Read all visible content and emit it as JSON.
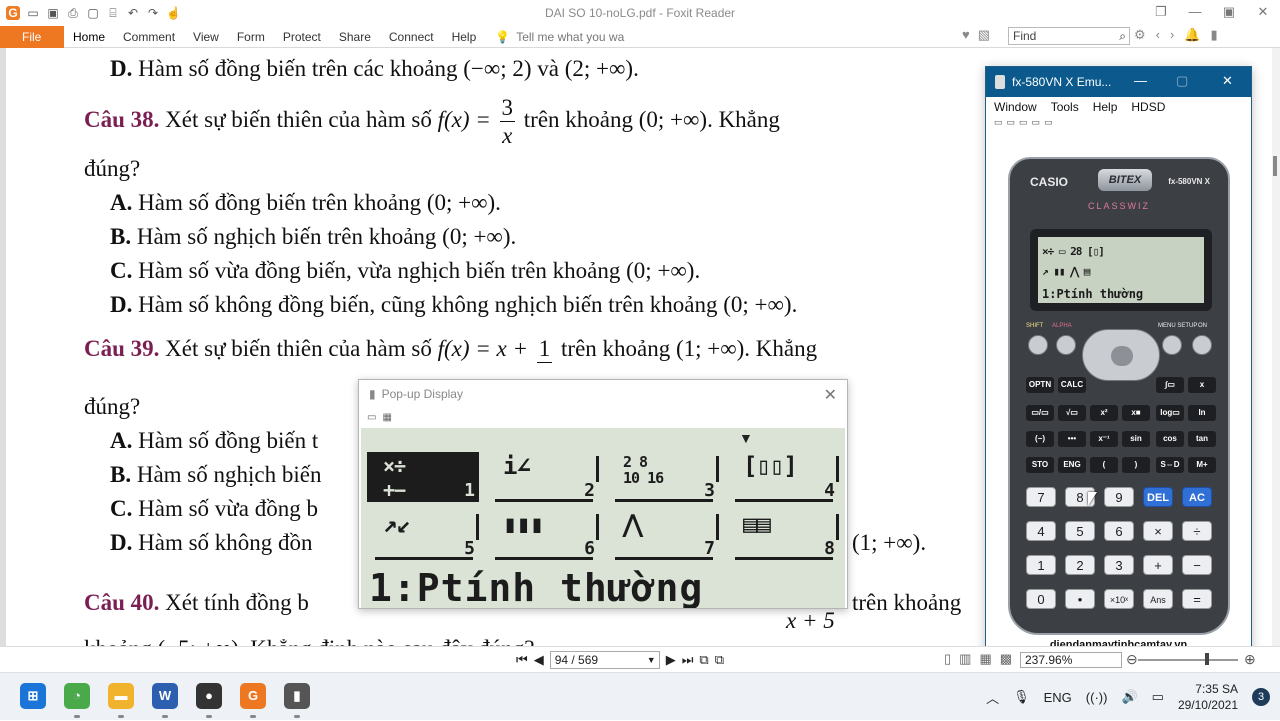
{
  "window": {
    "title": "DAI SO 10-noLG.pdf - Foxit Reader"
  },
  "ribbon": {
    "file": "File",
    "tabs": [
      "Home",
      "Comment",
      "View",
      "Form",
      "Protect",
      "Share",
      "Connect",
      "Help"
    ],
    "tell_me": "Tell me what you wa",
    "find_placeholder": "Find"
  },
  "document": {
    "line_d_top": "Hàm số đồng biến trên các khoảng (−∞; 2) và (2; +∞).",
    "q38": {
      "label": "Câu 38.",
      "text_before": "Xét sự biến thiên của hàm số",
      "func": "f(x) =",
      "num": "3",
      "den": "x",
      "text_after": "trên khoảng (0; +∞). Khẳng",
      "cont": "đúng?",
      "options": [
        {
          "letter": "A.",
          "text": "Hàm số đồng biến trên khoảng (0; +∞)."
        },
        {
          "letter": "B.",
          "text": "Hàm số nghịch biến trên khoảng (0; +∞)."
        },
        {
          "letter": "C.",
          "text": "Hàm số vừa đồng biến, vừa nghịch biến trên khoảng (0; +∞)."
        },
        {
          "letter": "D.",
          "text": "Hàm số không đồng biến, cũng không nghịch biến trên khoảng (0; +∞)."
        }
      ]
    },
    "q39": {
      "label": "Câu 39.",
      "text_before": "Xét sự biến thiên của hàm số",
      "func": "f(x) = x +",
      "num": "1",
      "den": "",
      "text_after": "trên khoảng (1; +∞). Khẳng",
      "cont": "đúng?",
      "options": [
        {
          "letter": "A.",
          "text": "Hàm số đồng biến t"
        },
        {
          "letter": "B.",
          "text": "Hàm số nghịch biến"
        },
        {
          "letter": "C.",
          "text": "Hàm số vừa đồng b"
        },
        {
          "letter": "D.",
          "text": "Hàm số không đồn"
        }
      ],
      "d_tail": "(1; +∞)."
    },
    "q40": {
      "label": "Câu 40.",
      "text_before": "Xét tính đồng b",
      "den_tail": "x + 5",
      "text_after": "trên khoảng"
    },
    "bottom_cut": "khoảng (−5; +∞). Khẳng định nào sau đây đúng?"
  },
  "statusbar": {
    "page": "94 / 569",
    "zoom": "237.96%"
  },
  "popup": {
    "title": "Pop-up Display",
    "menu_items": [
      {
        "glyph": "×÷\n+−",
        "num": "1",
        "selected": true
      },
      {
        "glyph": "i∠",
        "num": "2",
        "selected": false
      },
      {
        "glyph": "2 8\n10 16",
        "num": "3",
        "selected": false
      },
      {
        "glyph": "[▯▯]",
        "num": "4",
        "selected": false
      },
      {
        "glyph": "↗↙",
        "num": "5",
        "selected": false
      },
      {
        "glyph": "▮▮▮",
        "num": "6",
        "selected": false
      },
      {
        "glyph": "⋀",
        "num": "7",
        "selected": false
      },
      {
        "glyph": "▤▤",
        "num": "8",
        "selected": false
      }
    ],
    "status_text": "1:Ptính thường"
  },
  "emulator": {
    "title": "fx-580VN X Emu...",
    "menu": [
      "Window",
      "Tools",
      "Help",
      "HDSD"
    ],
    "brand": "CASIO",
    "badge": "BITEX",
    "model": "fx-580VN X",
    "series": "CLASSWIZ",
    "screen_row1": "×÷ ▭ 28 [▯]",
    "screen_row2": "↗ ▮▮ ⋀ ▤",
    "screen_text": "1:Ptính thường",
    "top_labels": {
      "shift": "SHIFT",
      "alpha": "ALPHA",
      "menu": "MENU SETUP",
      "on": "ON"
    },
    "func_keys": [
      [
        "OPTN",
        "CALC",
        "",
        "",
        "∫▭",
        "x"
      ],
      [
        "▭/▭",
        "√▭",
        "x²",
        "x■",
        "log▭",
        "ln"
      ],
      [
        "(−)",
        "•••",
        "x⁻¹",
        "sin",
        "cos",
        "tan"
      ],
      [
        "STO",
        "ENG",
        "(",
        ")",
        "S⇔D",
        "M+"
      ]
    ],
    "num_keys": [
      [
        "7",
        "8",
        "9",
        "DEL",
        "AC"
      ],
      [
        "4",
        "5",
        "6",
        "×",
        "÷"
      ],
      [
        "1",
        "2",
        "3",
        "+",
        "−"
      ],
      [
        "0",
        "•",
        "×10ˣ",
        "Ans",
        "="
      ]
    ],
    "website": "diendanmaytinhcamtay.vn"
  },
  "taskbar": {
    "apps": [
      {
        "name": "start",
        "label": "⊞",
        "color": "#1b74d8"
      },
      {
        "name": "app-green",
        "label": "◔",
        "color": "#4aa94b"
      },
      {
        "name": "explorer",
        "label": "▬",
        "color": "#f1b22d"
      },
      {
        "name": "word",
        "label": "W",
        "color": "#2d5fb0"
      },
      {
        "name": "obs",
        "label": "●",
        "color": "#333333"
      },
      {
        "name": "foxit",
        "label": "G",
        "color": "#ee7721"
      },
      {
        "name": "calc-emu",
        "label": "▮",
        "color": "#555555"
      }
    ],
    "lang": "ENG",
    "time": "7:35 SA",
    "date": "29/10/2021",
    "notifications": "3"
  }
}
